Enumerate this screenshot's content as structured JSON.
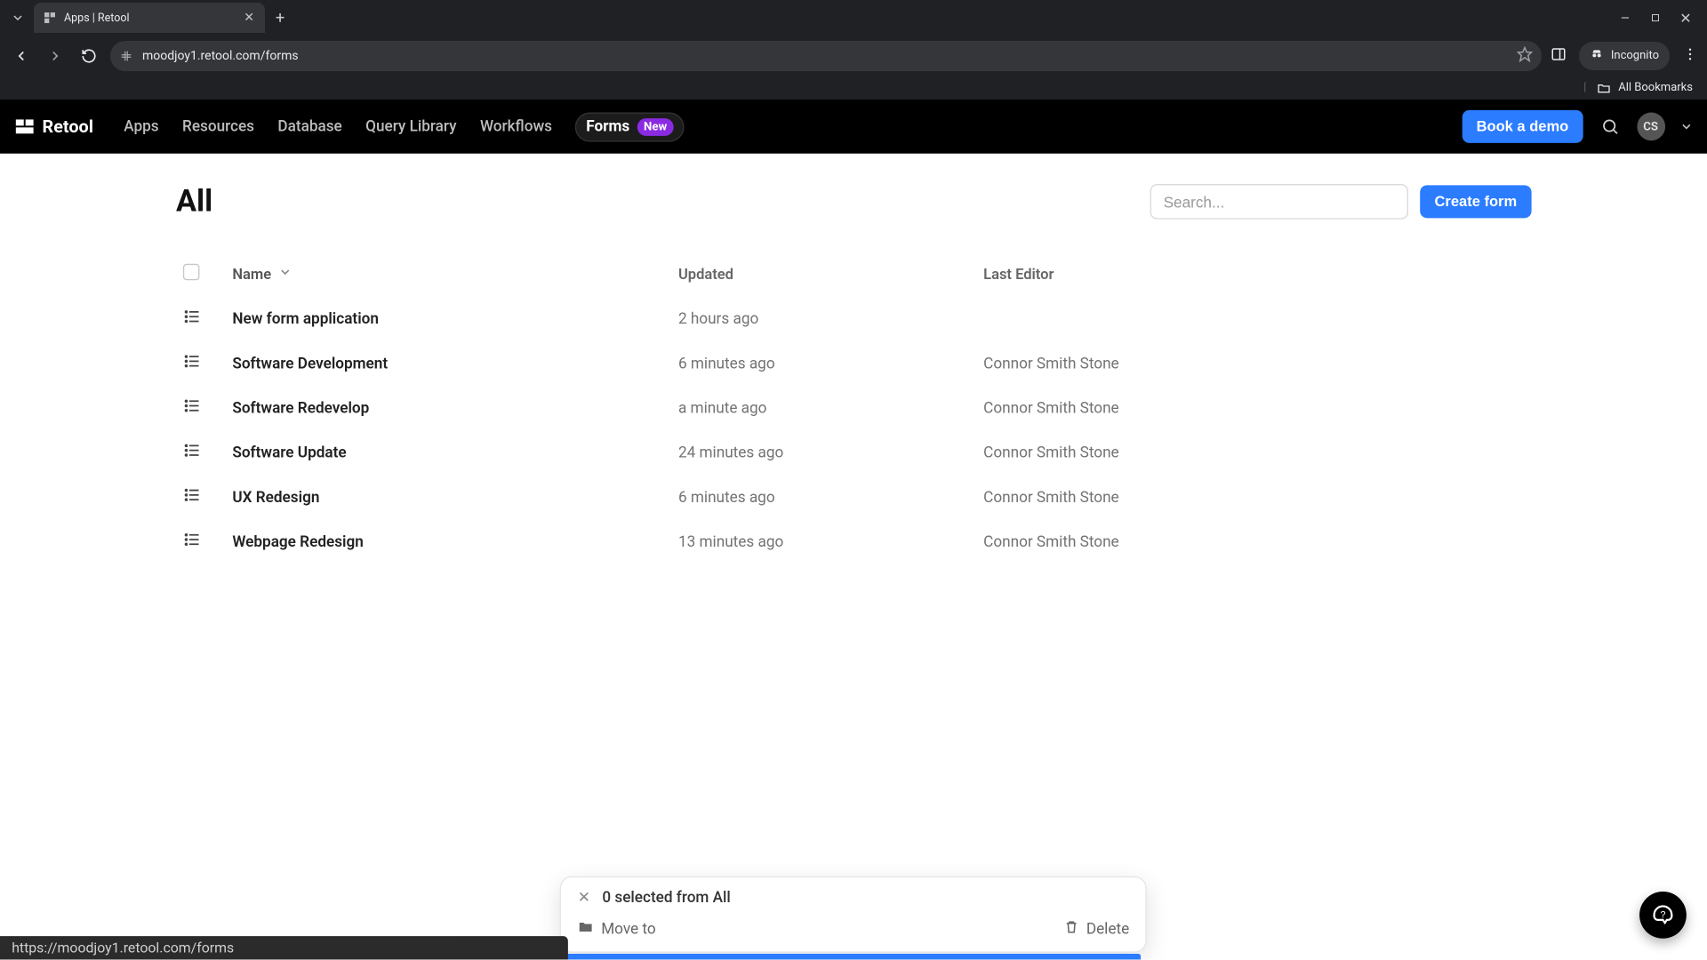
{
  "browser": {
    "tab_title": "Apps | Retool",
    "url": "moodjoy1.retool.com/forms",
    "incognito_label": "Incognito",
    "bookmarks_label": "All Bookmarks",
    "status_url": "https://moodjoy1.retool.com/forms"
  },
  "topbar": {
    "brand": "Retool",
    "links": {
      "apps": "Apps",
      "resources": "Resources",
      "database": "Database",
      "query_library": "Query Library",
      "workflows": "Workflows",
      "forms": "Forms",
      "new_badge": "New"
    },
    "book_demo": "Book a demo",
    "avatar_initials": "CS"
  },
  "page": {
    "title": "All",
    "search_placeholder": "Search...",
    "create_form_label": "Create form"
  },
  "table": {
    "headers": {
      "name": "Name",
      "updated": "Updated",
      "last_editor": "Last Editor"
    },
    "rows": [
      {
        "name": "New form application",
        "updated": "2 hours ago",
        "editor": ""
      },
      {
        "name": "Software Development",
        "updated": "6 minutes ago",
        "editor": "Connor Smith Stone"
      },
      {
        "name": "Software Redevelop",
        "updated": "a minute ago",
        "editor": "Connor Smith Stone"
      },
      {
        "name": "Software Update",
        "updated": "24 minutes ago",
        "editor": "Connor Smith Stone"
      },
      {
        "name": "UX Redesign",
        "updated": "6 minutes ago",
        "editor": "Connor Smith Stone"
      },
      {
        "name": "Webpage Redesign",
        "updated": "13 minutes ago",
        "editor": "Connor Smith Stone"
      }
    ]
  },
  "selection": {
    "text": "0 selected from All",
    "move_to": "Move to",
    "delete": "Delete"
  },
  "colors": {
    "primary": "#2b7cff",
    "badge_purple": "#8a2be2",
    "text_muted": "#737373"
  }
}
